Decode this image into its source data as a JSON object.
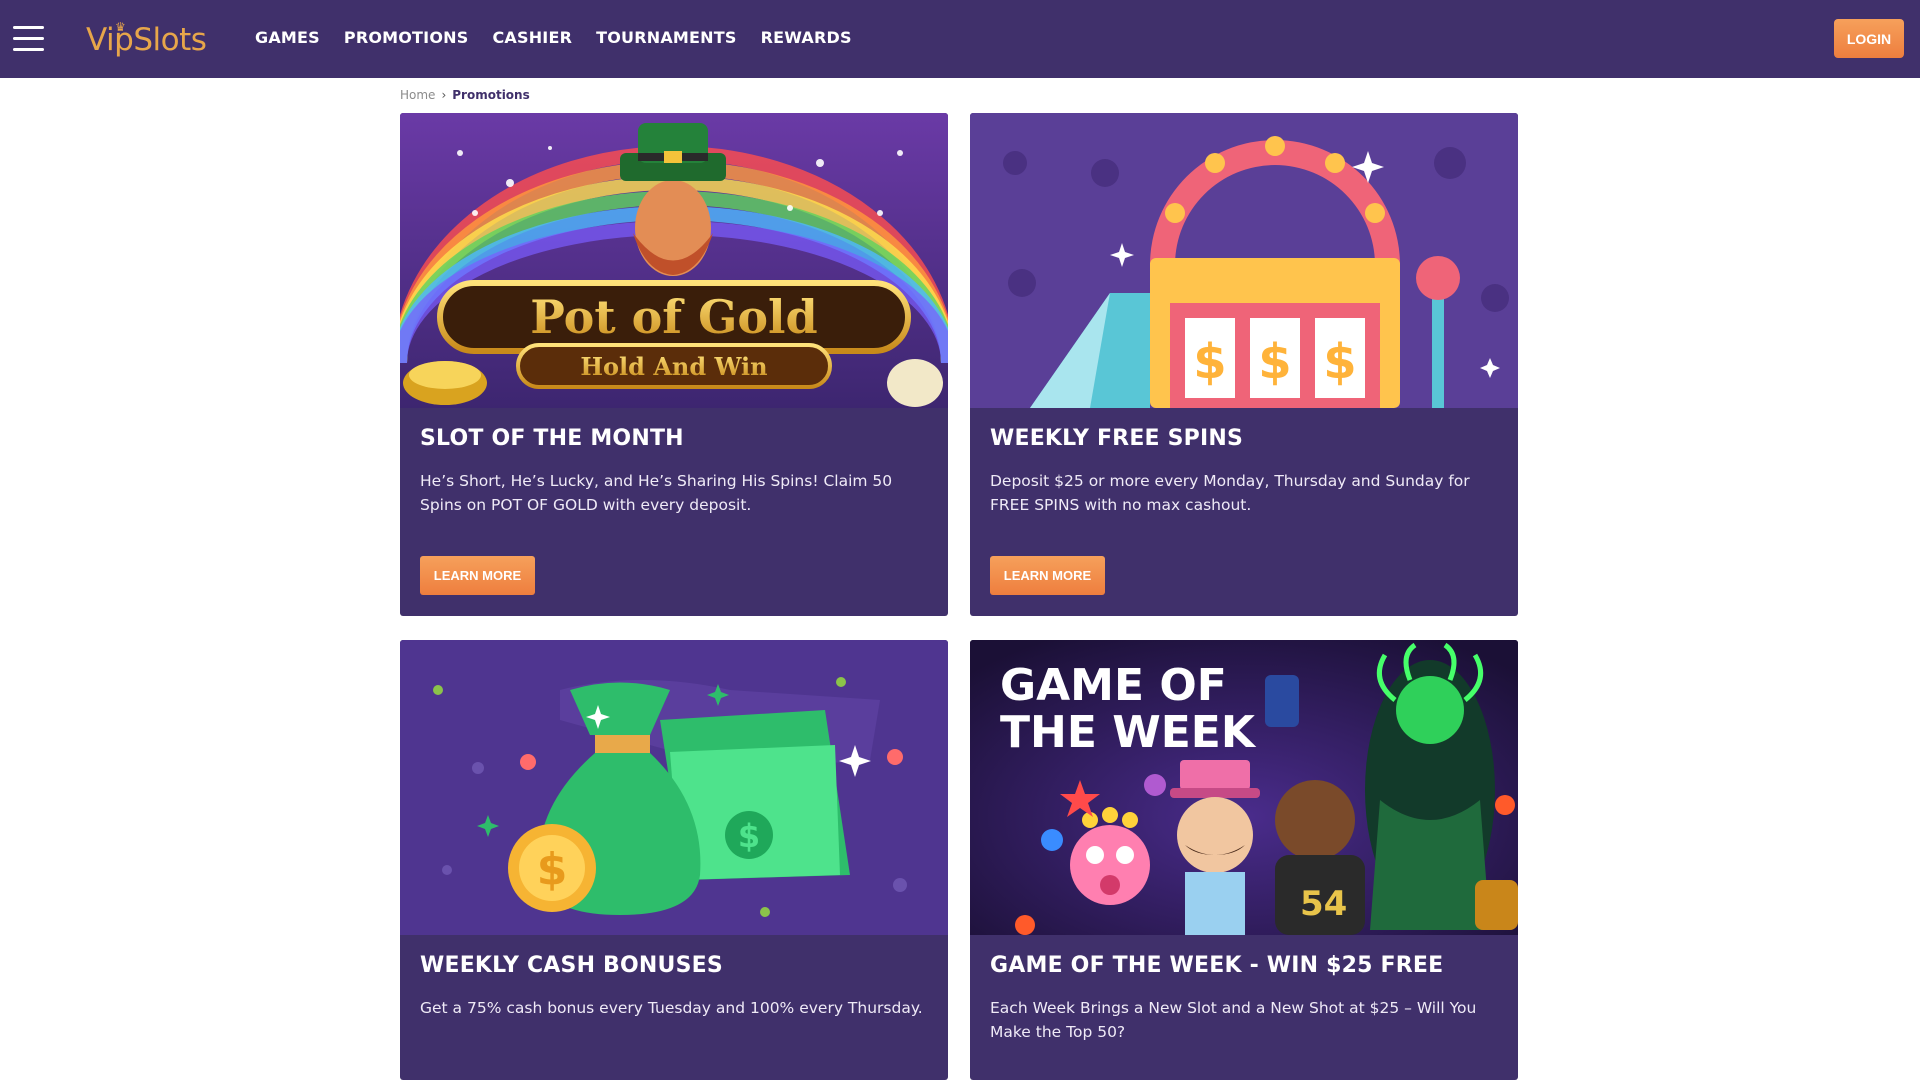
{
  "header": {
    "logo_text": "VipSlots",
    "nav": [
      "GAMES",
      "PROMOTIONS",
      "CASHIER",
      "TOURNAMENTS",
      "REWARDS"
    ],
    "login_label": "LOGIN"
  },
  "breadcrumb": {
    "home": "Home",
    "current": "Promotions"
  },
  "cards": [
    {
      "title": "SLOT OF THE MONTH",
      "description": "He’s Short, He’s Lucky, and He’s Sharing His Spins! Claim 50 Spins on POT OF GOLD with every deposit.",
      "button": "LEARN MORE",
      "image_title": "Pot of Gold",
      "image_subtitle": "Hold And Win"
    },
    {
      "title": "WEEKLY FREE SPINS",
      "description": "Deposit $25 or more every Monday, Thursday and Sunday for FREE SPINS with no max cashout.",
      "button": "LEARN MORE",
      "image_symbols": [
        "$",
        "$",
        "$"
      ]
    },
    {
      "title": "WEEKLY CASH BONUSES",
      "description": "Get a 75% cash bonus every Tuesday and 100% every Thursday.",
      "image_symbol": "$"
    },
    {
      "title": "GAME OF THE WEEK - WIN $25 FREE",
      "description": "Each Week Brings a New Slot and a New Shot at $25 – Will You Make the Top 50?",
      "image_title_line1": "GAME OF",
      "image_title_line2": "THE WEEK"
    }
  ],
  "colors": {
    "header_bg": "#40306b",
    "card_bg": "#40306b",
    "accent": "#f08a45",
    "logo": "#e7a64a"
  }
}
